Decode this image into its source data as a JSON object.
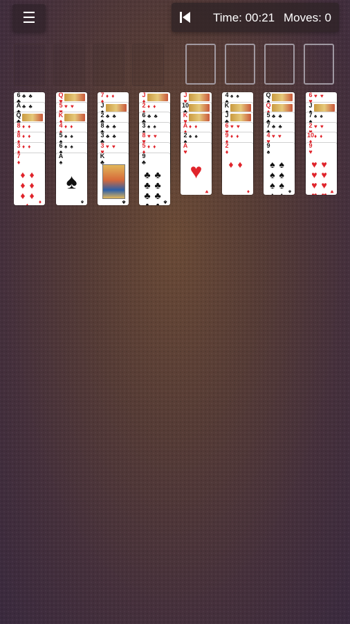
{
  "header": {
    "menu_icon": "hamburger-menu-icon",
    "undo_icon": "undo-skip-back-icon",
    "time_label": "Time: 00:21",
    "moves_label": "Moves: 0"
  },
  "colors": {
    "red": "#e0242b",
    "black": "#111111",
    "felt": "#563c36"
  },
  "columns": [
    {
      "cards": [
        {
          "rank": "6",
          "suit": "♣",
          "color": "black",
          "face": false
        },
        {
          "rank": "A",
          "suit": "♣",
          "color": "black",
          "face": false
        },
        {
          "rank": "Q",
          "suit": "♣",
          "color": "black",
          "face": true
        },
        {
          "rank": "8",
          "suit": "♦",
          "color": "red",
          "face": false
        },
        {
          "rank": "8",
          "suit": "♦",
          "color": "red",
          "face": false
        },
        {
          "rank": "3",
          "suit": "♦",
          "color": "red",
          "face": false
        },
        {
          "rank": "7",
          "suit": "♦",
          "color": "red",
          "face": false
        }
      ]
    },
    {
      "cards": [
        {
          "rank": "Q",
          "suit": "♥",
          "color": "red",
          "face": true
        },
        {
          "rank": "5",
          "suit": "♥",
          "color": "red",
          "face": false
        },
        {
          "rank": "K",
          "suit": "♦",
          "color": "red",
          "face": true
        },
        {
          "rank": "4",
          "suit": "♦",
          "color": "red",
          "face": false
        },
        {
          "rank": "5",
          "suit": "♠",
          "color": "black",
          "face": false
        },
        {
          "rank": "6",
          "suit": "♠",
          "color": "black",
          "face": false
        },
        {
          "rank": "A",
          "suit": "♠",
          "color": "black",
          "face": false
        }
      ]
    },
    {
      "cards": [
        {
          "rank": "7",
          "suit": "♦",
          "color": "red",
          "face": false
        },
        {
          "rank": "J",
          "suit": "♠",
          "color": "black",
          "face": true
        },
        {
          "rank": "2",
          "suit": "♣",
          "color": "black",
          "face": false
        },
        {
          "rank": "8",
          "suit": "♣",
          "color": "black",
          "face": false
        },
        {
          "rank": "3",
          "suit": "♣",
          "color": "black",
          "face": false
        },
        {
          "rank": "3",
          "suit": "♥",
          "color": "red",
          "face": false
        },
        {
          "rank": "K",
          "suit": "♣",
          "color": "black",
          "face": true
        }
      ]
    },
    {
      "cards": [
        {
          "rank": "J",
          "suit": "♦",
          "color": "red",
          "face": true
        },
        {
          "rank": "2",
          "suit": "♦",
          "color": "red",
          "face": false
        },
        {
          "rank": "6",
          "suit": "♣",
          "color": "black",
          "face": false
        },
        {
          "rank": "3",
          "suit": "♠",
          "color": "black",
          "face": false
        },
        {
          "rank": "8",
          "suit": "♥",
          "color": "red",
          "face": false
        },
        {
          "rank": "5",
          "suit": "♦",
          "color": "red",
          "face": false
        },
        {
          "rank": "9",
          "suit": "♣",
          "color": "black",
          "face": false
        }
      ]
    },
    {
      "cards": [
        {
          "rank": "J",
          "suit": "♥",
          "color": "red",
          "face": true
        },
        {
          "rank": "10",
          "suit": "♣",
          "color": "black",
          "face": true
        },
        {
          "rank": "K",
          "suit": "♥",
          "color": "red",
          "face": true
        },
        {
          "rank": "A",
          "suit": "♦",
          "color": "red",
          "face": false
        },
        {
          "rank": "2",
          "suit": "♠",
          "color": "black",
          "face": false
        },
        {
          "rank": "A",
          "suit": "♥",
          "color": "red",
          "face": false
        }
      ]
    },
    {
      "cards": [
        {
          "rank": "4",
          "suit": "♠",
          "color": "black",
          "face": false
        },
        {
          "rank": "K",
          "suit": "♠",
          "color": "black",
          "face": true
        },
        {
          "rank": "J",
          "suit": "♣",
          "color": "black",
          "face": true
        },
        {
          "rank": "6",
          "suit": "♥",
          "color": "red",
          "face": false
        },
        {
          "rank": "9",
          "suit": "♦",
          "color": "red",
          "face": false
        },
        {
          "rank": "2",
          "suit": "♦",
          "color": "red",
          "face": false
        }
      ]
    },
    {
      "cards": [
        {
          "rank": "Q",
          "suit": "♠",
          "color": "black",
          "face": true
        },
        {
          "rank": "Q",
          "suit": "♦",
          "color": "red",
          "face": true
        },
        {
          "rank": "5",
          "suit": "♣",
          "color": "black",
          "face": false
        },
        {
          "rank": "7",
          "suit": "♣",
          "color": "black",
          "face": false
        },
        {
          "rank": "4",
          "suit": "♥",
          "color": "red",
          "face": false
        },
        {
          "rank": "9",
          "suit": "♠",
          "color": "black",
          "face": false
        }
      ]
    },
    {
      "cards": [
        {
          "rank": "6",
          "suit": "♥",
          "color": "red",
          "face": false
        },
        {
          "rank": "J",
          "suit": "♠",
          "color": "black",
          "face": true
        },
        {
          "rank": "7",
          "suit": "♠",
          "color": "black",
          "face": false
        },
        {
          "rank": "2",
          "suit": "♥",
          "color": "red",
          "face": false
        },
        {
          "rank": "10",
          "suit": "♦",
          "color": "red",
          "face": false
        },
        {
          "rank": "9",
          "suit": "♥",
          "color": "red",
          "face": false
        }
      ]
    }
  ]
}
